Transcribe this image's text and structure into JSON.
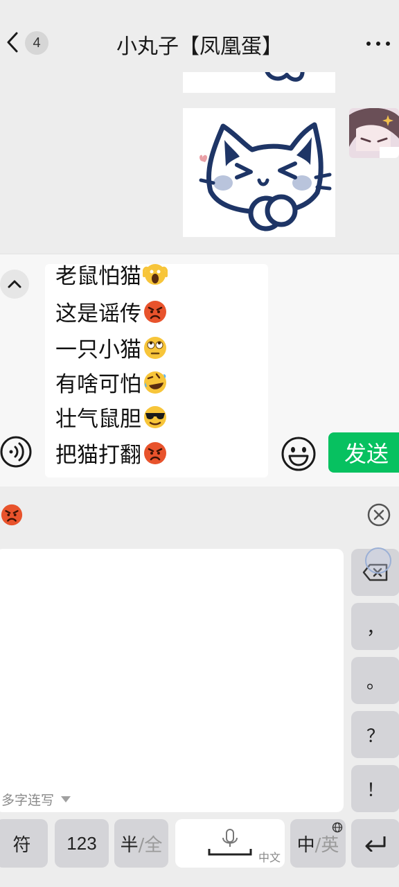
{
  "header": {
    "unread_count": "4",
    "title": "小丸子【凤凰蛋】"
  },
  "input": {
    "lines": [
      {
        "text": "老鼠怕猫",
        "emoji": "scream-emoji"
      },
      {
        "text": "这是谣传",
        "emoji": "angry-emoji"
      },
      {
        "text": "一只小猫",
        "emoji": "eye-roll-emoji"
      },
      {
        "text": "有啥可怕",
        "emoji": "rofl-emoji"
      },
      {
        "text": "壮气鼠胆",
        "emoji": "sunglasses-emoji"
      },
      {
        "text": "把猫打翻",
        "emoji": "angry-emoji"
      }
    ],
    "send_label": "发送"
  },
  "keyboard": {
    "candidate_emoji": "angry-emoji",
    "handwriting_hint": "多字连写",
    "keys": {
      "comma": "，",
      "period": "。",
      "question": "？",
      "exclaim": "！",
      "symbol": "符",
      "numbers": "123",
      "half_main": "半",
      "half_sep": "/全",
      "space_sub": "中文",
      "lang_main": "中",
      "lang_sep": "/英"
    }
  },
  "colors": {
    "send": "#07c160",
    "background": "#ededed",
    "angry_emoji": "#e8532c"
  }
}
